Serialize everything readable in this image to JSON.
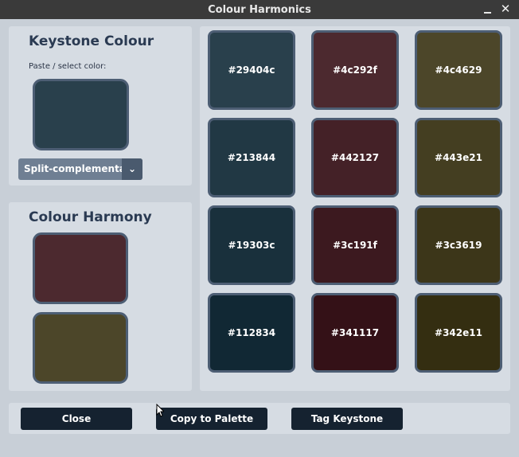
{
  "window": {
    "title": "Colour Harmonics"
  },
  "keystone": {
    "heading": "Keystone Colour",
    "paste_label": "Paste / select color:",
    "swatch_color": "#29404c",
    "harmony_type": "Split-complementary"
  },
  "harmony": {
    "heading": "Colour Harmony",
    "swatches": [
      "#4c292f",
      "#4c4629"
    ]
  },
  "grid": {
    "cells": [
      "#29404c",
      "#4c292f",
      "#4c4629",
      "#213844",
      "#442127",
      "#443e21",
      "#19303c",
      "#3c191f",
      "#3c3619",
      "#112834",
      "#341117",
      "#342e11"
    ]
  },
  "buttons": {
    "close": "Close",
    "copy": "Copy to Palette",
    "tag": "Tag Keystone"
  }
}
